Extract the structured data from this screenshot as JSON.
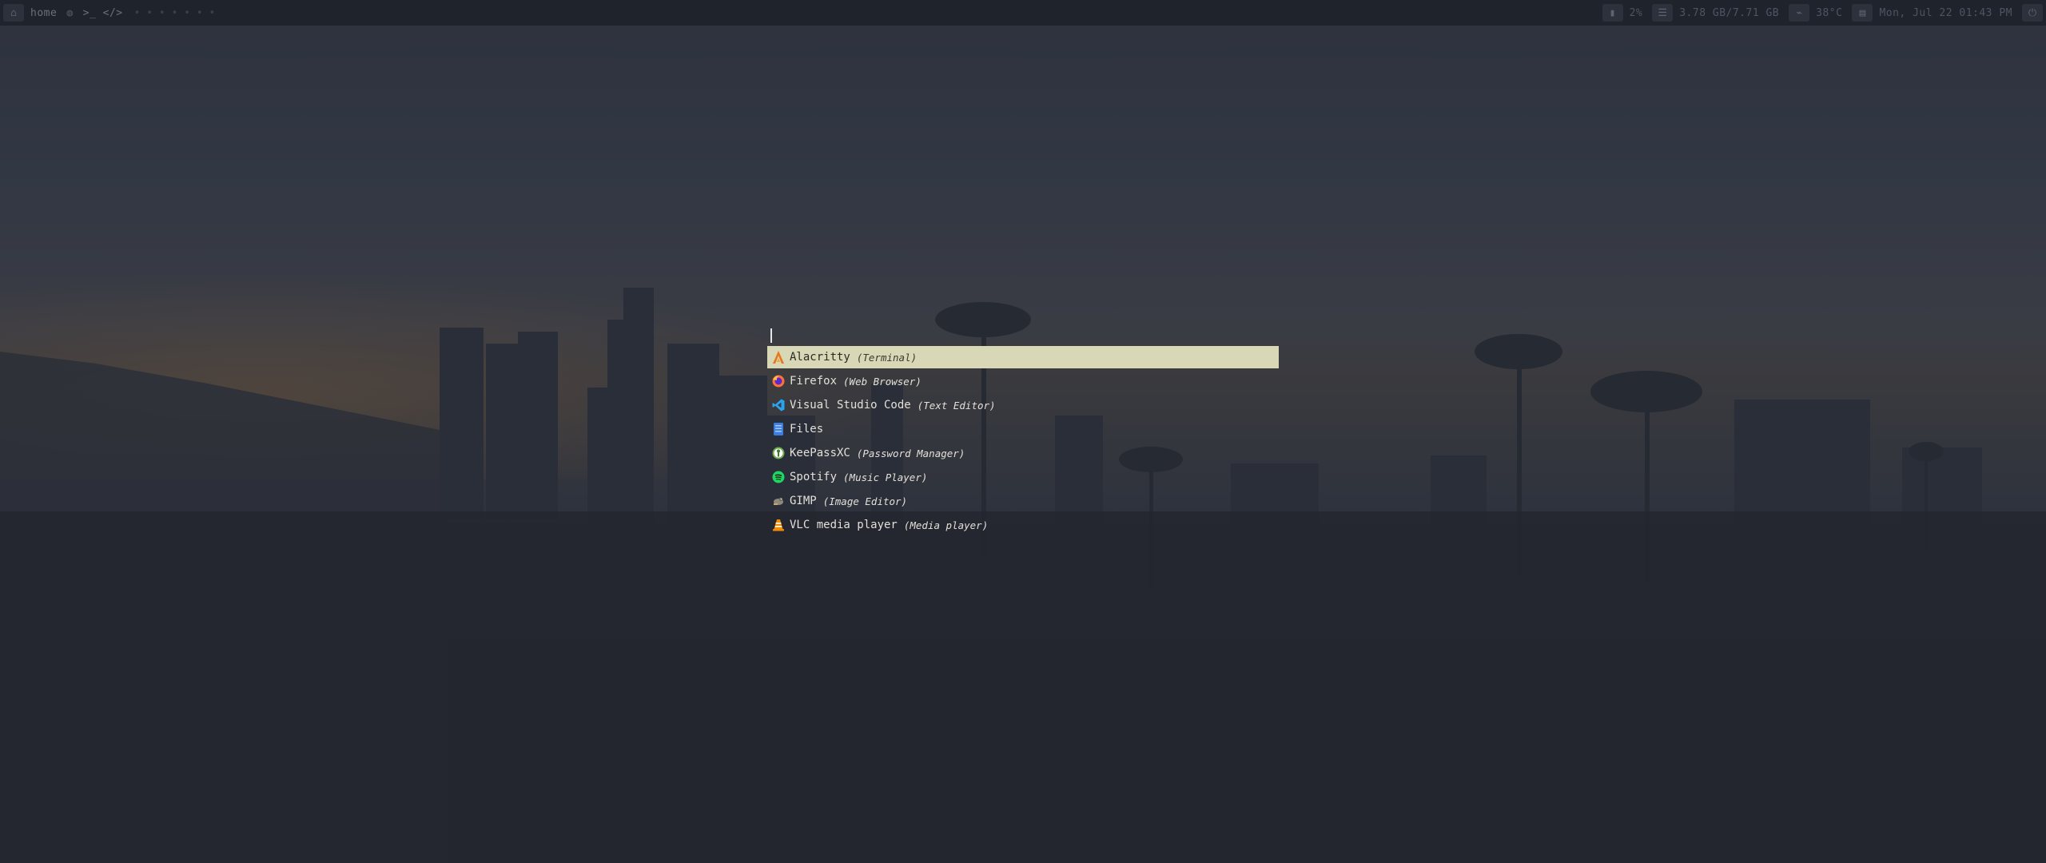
{
  "topbar": {
    "left": {
      "home_icon": "home-icon",
      "hostname": "home",
      "globe_icon": "globe-icon",
      "workspace_icons": ">_  </>",
      "workspaces": [
        "• • • • • • •"
      ]
    },
    "right": {
      "cpu_value": "2%",
      "memory_value": "3.78 GB/7.71 GB",
      "temperature_value": "38°C",
      "datetime_value": "Mon, Jul 22 01:43 PM"
    }
  },
  "launcher": {
    "query": "",
    "items": [
      {
        "name": "Alacritty",
        "desc": "(Terminal)",
        "icon": "alacritty-icon",
        "selected": true
      },
      {
        "name": "Firefox",
        "desc": "(Web Browser)",
        "icon": "firefox-icon",
        "selected": false
      },
      {
        "name": "Visual Studio Code",
        "desc": "(Text Editor)",
        "icon": "vscode-icon",
        "selected": false
      },
      {
        "name": "Files",
        "desc": "",
        "icon": "files-icon",
        "selected": false
      },
      {
        "name": "KeePassXC",
        "desc": "(Password Manager)",
        "icon": "keepassxc-icon",
        "selected": false
      },
      {
        "name": "Spotify",
        "desc": "(Music Player)",
        "icon": "spotify-icon",
        "selected": false
      },
      {
        "name": "GIMP",
        "desc": "(Image Editor)",
        "icon": "gimp-icon",
        "selected": false
      },
      {
        "name": "VLC media player",
        "desc": "(Media player)",
        "icon": "vlc-icon",
        "selected": false
      }
    ]
  },
  "colors": {
    "bar_bg": "#1f232c",
    "selected_bg": "#d8d7b6",
    "text": "#e2e0d8"
  }
}
